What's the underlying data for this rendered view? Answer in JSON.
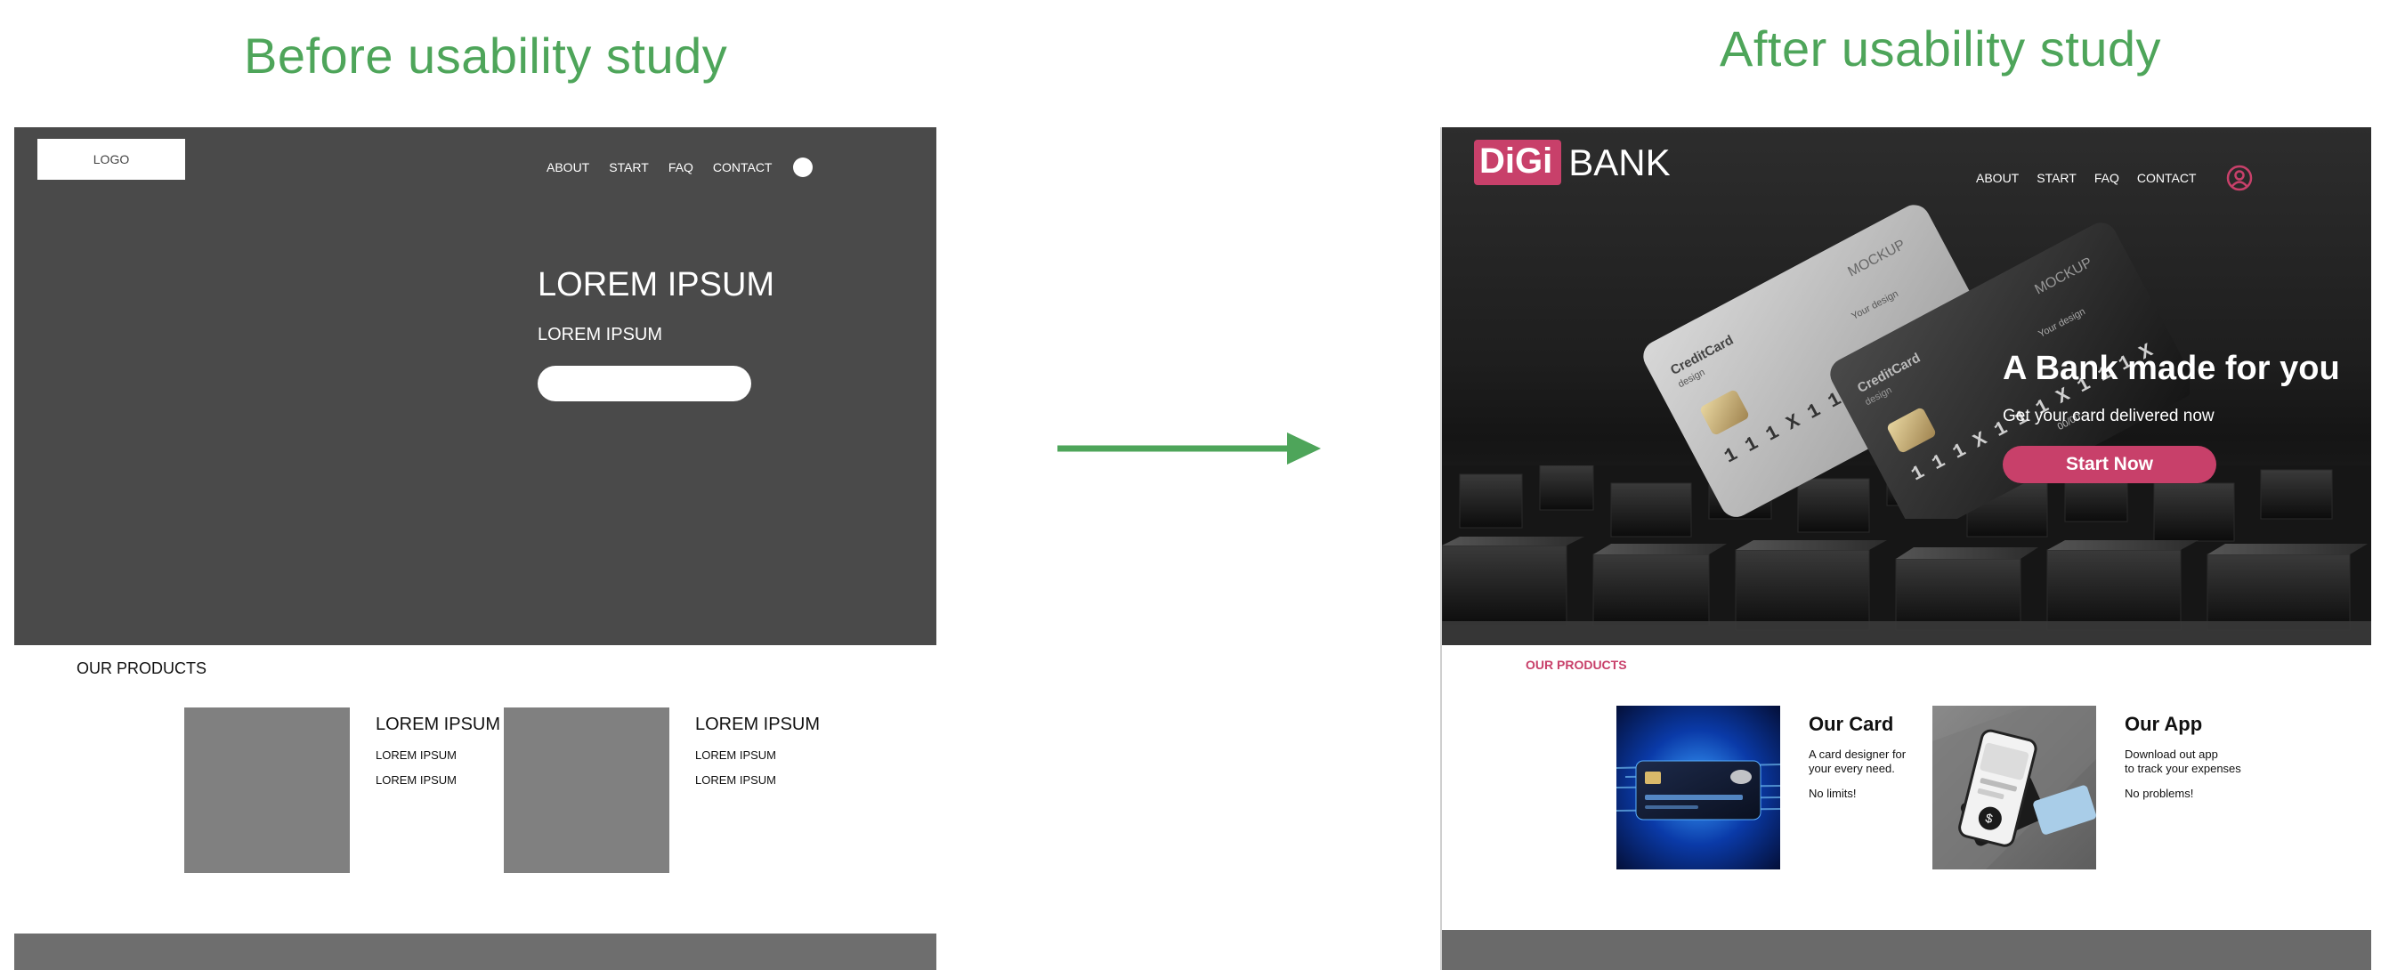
{
  "headings": {
    "before": "Before usability study",
    "after": "After usability study"
  },
  "wireframe": {
    "logo": "LOGO",
    "nav": [
      "ABOUT",
      "START",
      "FAQ",
      "CONTACT"
    ],
    "hero": {
      "title": "LOREM IPSUM",
      "subtitle": "LOREM IPSUM"
    },
    "products_label": "OUR PRODUCTS",
    "products": [
      {
        "title": "LOREM IPSUM",
        "line1": "LOREM IPSUM",
        "line2": "LOREM IPSUM"
      },
      {
        "title": "LOREM IPSUM",
        "line1": "LOREM IPSUM",
        "line2": "LOREM IPSUM"
      }
    ]
  },
  "mockup": {
    "logo_mark": "DiGi",
    "logo_text": "BANK",
    "nav": [
      "ABOUT",
      "START",
      "FAQ",
      "CONTACT"
    ],
    "hero": {
      "title": "A Bank made for you",
      "subtitle": "Get your card delivered now",
      "cta": "Start Now"
    },
    "products_label": "OUR PRODUCTS",
    "products": [
      {
        "title": "Our Card",
        "line1": "A card designer for",
        "line2": "your every need.",
        "line3": "No limits!"
      },
      {
        "title": "Our App",
        "line1": "Download out app",
        "line2": "to track your expenses",
        "line3": "No problems!"
      }
    ],
    "card_print": {
      "brand": "CreditCard",
      "brand_sub": "design",
      "mockup": "MOCKUP",
      "your_design": "Your design",
      "number": "1 1 1 X   1 1 1 X   1 1 1 X",
      "date": "00/00"
    }
  },
  "colors": {
    "heading_green": "#4ea55a",
    "arrow_green": "#4ea55a",
    "brand_pink": "#c8406a",
    "wireframe_gray": "#4a4a4a",
    "placeholder_gray": "#808080"
  },
  "icons": {
    "user": "user-circle-icon",
    "arrow": "arrow-right-icon"
  }
}
